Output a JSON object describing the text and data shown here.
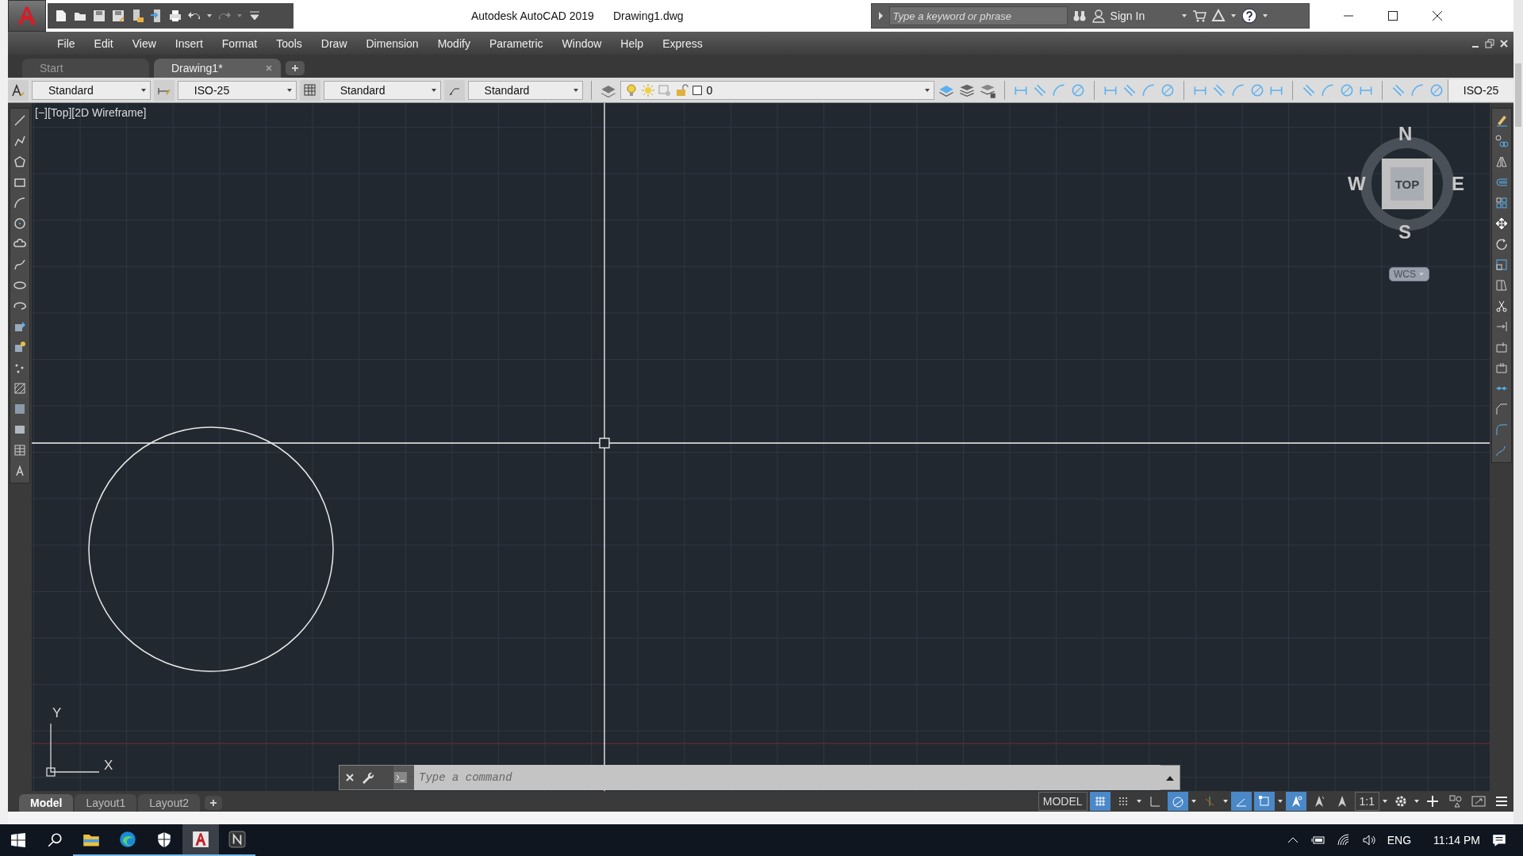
{
  "window": {
    "title": "Autodesk AutoCAD 2019",
    "file": "Drawing1.dwg"
  },
  "search": {
    "placeholder": "Type a keyword or phrase"
  },
  "sign_in": "Sign In",
  "menu": [
    "File",
    "Edit",
    "View",
    "Insert",
    "Format",
    "Tools",
    "Draw",
    "Dimension",
    "Modify",
    "Parametric",
    "Window",
    "Help",
    "Express"
  ],
  "file_tabs": [
    {
      "label": "Start",
      "selected": false
    },
    {
      "label": "Drawing1*",
      "selected": true
    }
  ],
  "styles_toolbar": {
    "text_style": "Standard",
    "dim_style": "ISO-25",
    "table_style": "Standard",
    "multileader_style": "Standard"
  },
  "layer": {
    "name": "0"
  },
  "current_dim_style": "ISO-25",
  "viewport": {
    "label": "[−][Top][2D Wireframe]"
  },
  "viewcube": {
    "north": "N",
    "west": "W",
    "east": "E",
    "south": "S",
    "face": "TOP",
    "ucs": "WCS"
  },
  "ucs_icon": {
    "y": "Y",
    "x": "X"
  },
  "command_line": {
    "placeholder": "Type a command"
  },
  "layout_tabs": [
    {
      "label": "Model",
      "selected": true
    },
    {
      "label": "Layout1",
      "selected": false
    },
    {
      "label": "Layout2",
      "selected": false
    }
  ],
  "status_bar": {
    "space": "MODEL",
    "scale": "1:1",
    "toggles": [
      {
        "kind": "grid",
        "on": true
      },
      {
        "kind": "snap",
        "on": false
      },
      {
        "kind": "ortho",
        "on": false
      },
      {
        "kind": "polar",
        "on": true
      },
      {
        "kind": "isodraft",
        "on": false
      },
      {
        "kind": "tracking",
        "on": true
      },
      {
        "kind": "osnap",
        "on": true
      },
      {
        "kind": "annovis",
        "on": true
      },
      {
        "kind": "autoscale",
        "on": false
      },
      {
        "kind": "annoscale",
        "on": false
      }
    ]
  },
  "taskbar": {
    "language": "ENG",
    "time": "11:14 PM",
    "apps": [
      {
        "kind": "folder",
        "active": false
      },
      {
        "kind": "browser",
        "active": false
      },
      {
        "kind": "shield",
        "active": false
      },
      {
        "kind": "autocad",
        "active": true
      },
      {
        "kind": "notes",
        "active": false
      }
    ]
  }
}
